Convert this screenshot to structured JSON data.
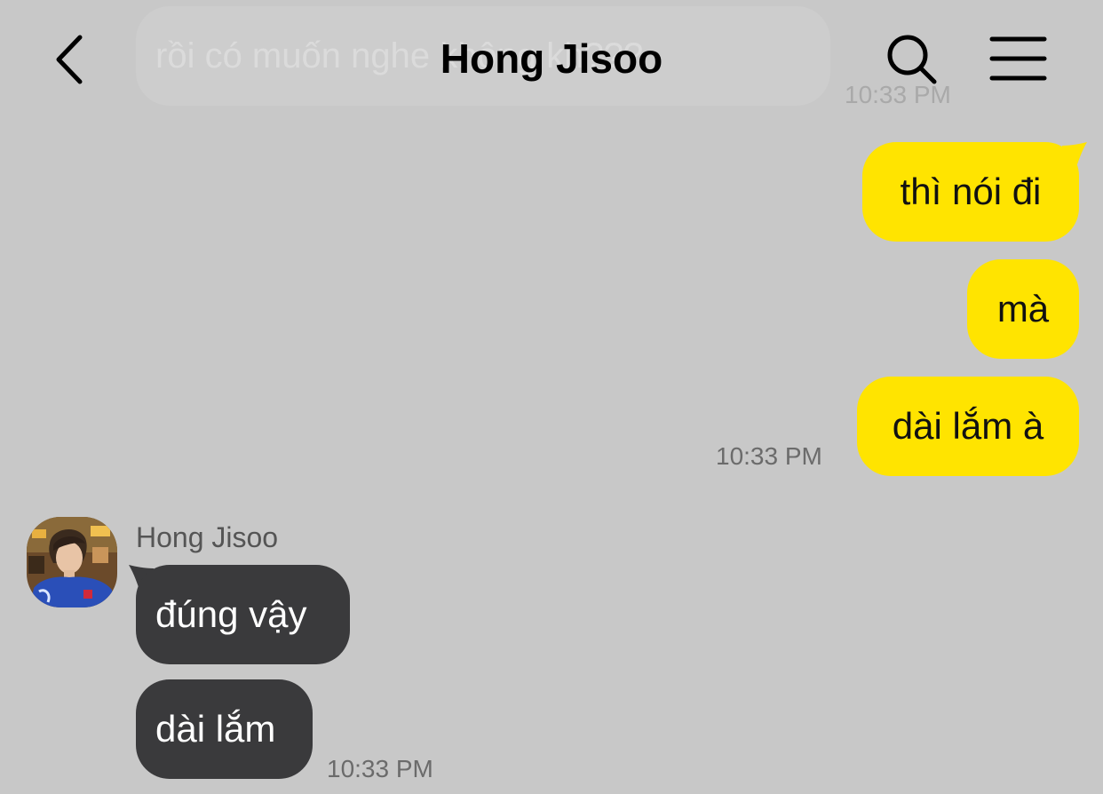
{
  "header": {
    "title": "Hong Jisoo",
    "back_icon": "chevron-left-icon",
    "search_icon": "search-icon",
    "menu_icon": "hamburger-menu-icon"
  },
  "colors": {
    "background": "#c8c8c8",
    "my_bubble": "#ffe400",
    "their_bubble": "#3a3a3c"
  },
  "previous_message": {
    "text": "rồi có muốn nghe không kh???",
    "time": "10:33 PM"
  },
  "my_messages": {
    "items": [
      "thì nói đi",
      "mà",
      "dài lắm à"
    ],
    "time": "10:33 PM"
  },
  "their_messages": {
    "sender": "Hong Jisoo",
    "items": [
      "đúng vậy",
      "dài lắm"
    ],
    "time": "10:33 PM"
  }
}
